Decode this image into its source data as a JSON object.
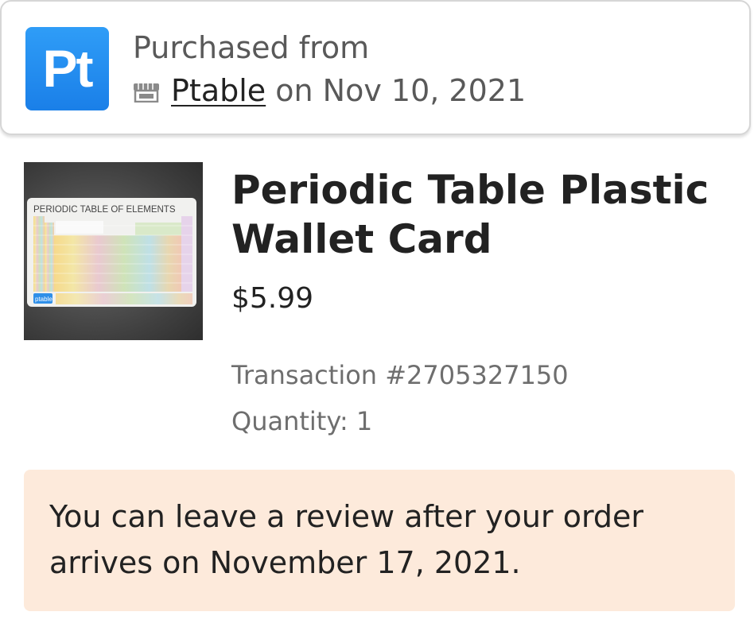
{
  "shop": {
    "logo_text": "Pt",
    "logo_color": "#1f87ee",
    "purchased_label": "Purchased from",
    "store_icon": "store-icon",
    "shop_name": "Ptable",
    "date_text": "on Nov 10, 2021"
  },
  "product": {
    "image_caption": "PERIODIC TABLE OF ELEMENTS",
    "image_brand": "ptable",
    "title": "Periodic Table Plastic Wallet Card",
    "price": "$5.99",
    "transaction": "Transaction #2705327150",
    "quantity": "Quantity: 1"
  },
  "notice": {
    "text": "You can leave a review after your order arrives on November 17, 2021.",
    "background": "#fdeadb"
  }
}
